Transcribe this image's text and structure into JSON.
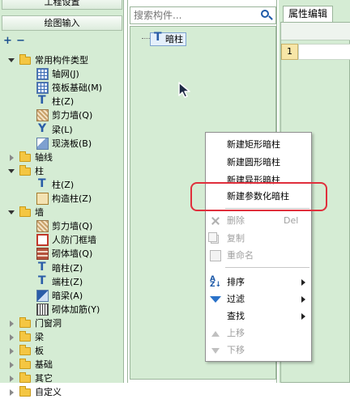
{
  "left_panel": {
    "tab_project": "工程设置",
    "tab_draw": "绘图输入",
    "toolbar": {
      "expand": "+",
      "collapse": "−"
    },
    "tree": [
      {
        "label": "常用构件类型",
        "level": 0,
        "kind": "folder",
        "state": "open"
      },
      {
        "label": "轴网(J)",
        "level": 1,
        "kind": "grid"
      },
      {
        "label": "筏板基础(M)",
        "level": 1,
        "kind": "grid"
      },
      {
        "label": "柱(Z)",
        "level": 1,
        "kind": "col"
      },
      {
        "label": "剪力墙(Q)",
        "level": 1,
        "kind": "wall"
      },
      {
        "label": "梁(L)",
        "level": 1,
        "kind": "beam"
      },
      {
        "label": "现浇板(B)",
        "level": 1,
        "kind": "slab"
      },
      {
        "label": "轴线",
        "level": 0,
        "kind": "folder",
        "state": "closed"
      },
      {
        "label": "柱",
        "level": 0,
        "kind": "folder",
        "state": "open"
      },
      {
        "label": "柱(Z)",
        "level": 1,
        "kind": "col"
      },
      {
        "label": "构造柱(Z)",
        "level": 1,
        "kind": "construct"
      },
      {
        "label": "墙",
        "level": 0,
        "kind": "folder",
        "state": "open"
      },
      {
        "label": "剪力墙(Q)",
        "level": 1,
        "kind": "wall"
      },
      {
        "label": "人防门框墙",
        "level": 1,
        "kind": "frame"
      },
      {
        "label": "砌体墙(Q)",
        "level": 1,
        "kind": "brick"
      },
      {
        "label": "暗柱(Z)",
        "level": 1,
        "kind": "col"
      },
      {
        "label": "端柱(Z)",
        "level": 1,
        "kind": "col"
      },
      {
        "label": "暗梁(A)",
        "level": 1,
        "kind": "darkbeam"
      },
      {
        "label": "砌体加筋(Y)",
        "level": 1,
        "kind": "rebar"
      },
      {
        "label": "门窗洞",
        "level": 0,
        "kind": "folder",
        "state": "closed"
      },
      {
        "label": "梁",
        "level": 0,
        "kind": "folder",
        "state": "closed"
      },
      {
        "label": "板",
        "level": 0,
        "kind": "folder",
        "state": "closed"
      },
      {
        "label": "基础",
        "level": 0,
        "kind": "folder",
        "state": "closed"
      },
      {
        "label": "其它",
        "level": 0,
        "kind": "folder",
        "state": "closed"
      },
      {
        "label": "自定义",
        "level": 0,
        "kind": "folder",
        "state": "closed"
      }
    ]
  },
  "middle_panel": {
    "search_placeholder": "搜索构件...",
    "selected_item": "暗柱"
  },
  "right_panel": {
    "tab_label": "属性编辑",
    "first_row_number": "1"
  },
  "context_menu": {
    "new_rect": "新建矩形暗柱",
    "new_round": "新建圆形暗柱",
    "new_irregular": "新建异形暗柱",
    "new_param": "新建参数化暗柱",
    "delete": "删除",
    "delete_shortcut": "Del",
    "copy": "复制",
    "rename": "重命名",
    "sort": "排序",
    "filter": "过滤",
    "find": "查找",
    "move_up": "上移",
    "move_down": "下移"
  },
  "colors": {
    "panel_bg": "#d5ecd4",
    "highlight": "#e02f3c",
    "accent": "#1e5aa8"
  }
}
